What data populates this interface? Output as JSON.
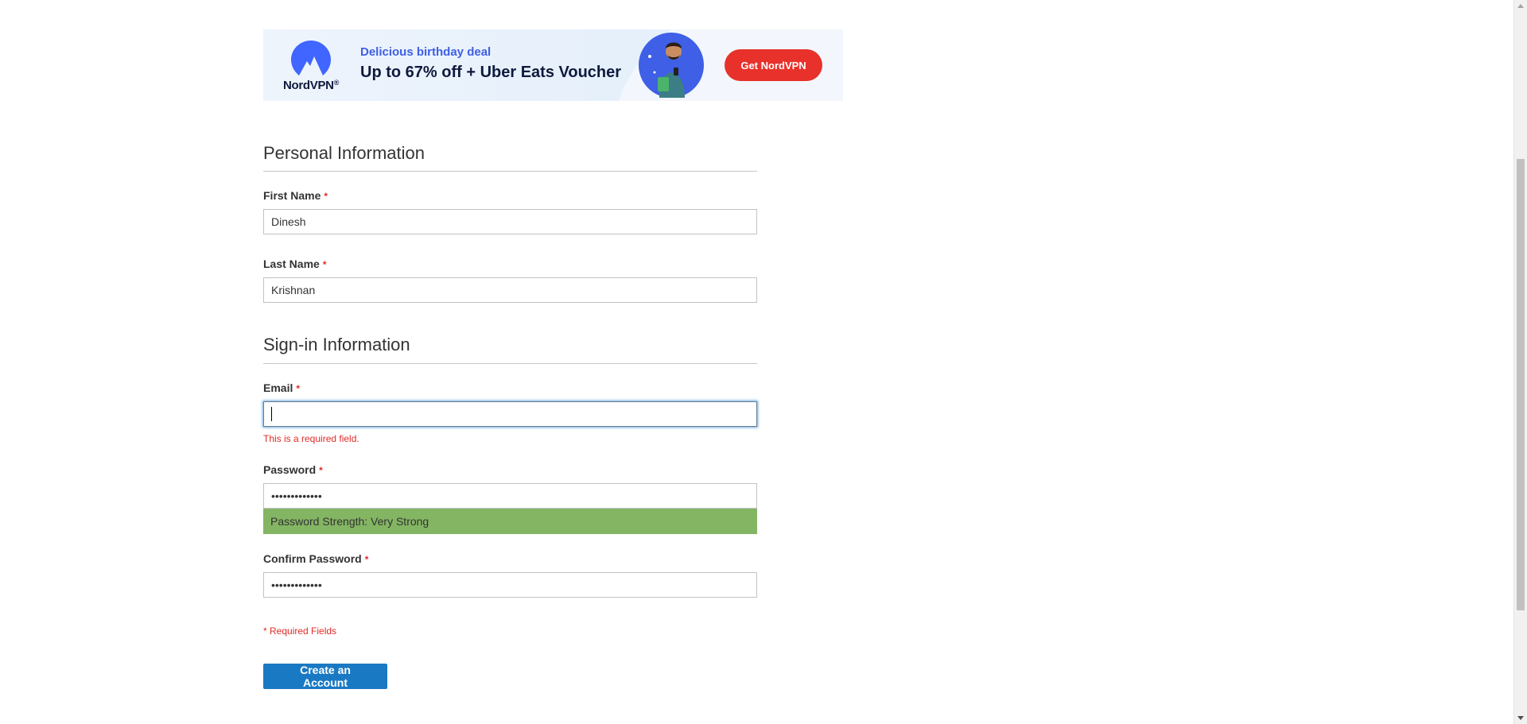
{
  "ad": {
    "brand": "NordVPN",
    "brand_mark": "®",
    "eyebrow": "Delicious birthday deal",
    "headline": "Up to 67% off + Uber Eats Voucher",
    "cta_label": "Get NordVPN",
    "colors": {
      "accent_blue": "#3e5fe6",
      "cta_red": "#e8312b"
    }
  },
  "personal": {
    "legend": "Personal Information",
    "first_name": {
      "label": "First Name",
      "required_mark": "*",
      "value": "Dinesh"
    },
    "last_name": {
      "label": "Last Name",
      "required_mark": "*",
      "value": "Krishnan"
    }
  },
  "signin": {
    "legend": "Sign-in Information",
    "email": {
      "label": "Email",
      "required_mark": "*",
      "value": "",
      "error": "This is a required field."
    },
    "password": {
      "label": "Password",
      "required_mark": "*",
      "value": "•••••••••••••",
      "strength_text": "Password Strength: Very Strong"
    },
    "confirm_password": {
      "label": "Confirm Password",
      "required_mark": "*",
      "value": "•••••••••••••"
    }
  },
  "required_note": "* Required Fields",
  "submit_label": "Create an Account",
  "colors": {
    "primary_button": "#1979c3",
    "error": "#e02b27",
    "strength_very_strong": "#84b563"
  }
}
